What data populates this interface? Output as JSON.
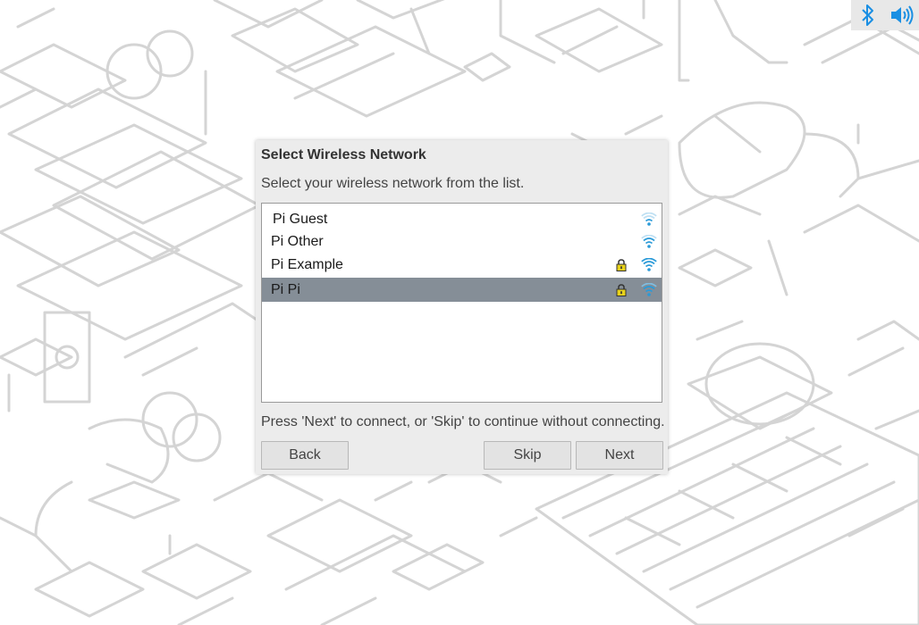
{
  "tray": {
    "icons": [
      "bluetooth-icon",
      "volume-icon"
    ],
    "accent": "#1a8fe3"
  },
  "dialog": {
    "title": "Select Wireless Network",
    "instruction": "Select your wireless network from the list.",
    "networks": [
      {
        "name": "Pi Guest",
        "secured": false,
        "signal": "weak",
        "selected": false
      },
      {
        "name": "Pi Other",
        "secured": false,
        "signal": "medium",
        "selected": false
      },
      {
        "name": "Pi Example",
        "secured": true,
        "signal": "strong",
        "selected": false
      },
      {
        "name": "Pi Pi",
        "secured": true,
        "signal": "strong",
        "selected": true
      }
    ],
    "footer": "Press 'Next' to connect, or 'Skip' to continue without connecting.",
    "buttons": {
      "back": "Back",
      "skip": "Skip",
      "next": "Next"
    }
  },
  "colors": {
    "selection": "#858e97",
    "wifi": "#2a9ad8",
    "lock": "#e8d21a",
    "wallpaper_lines": "#d2d2d2"
  }
}
